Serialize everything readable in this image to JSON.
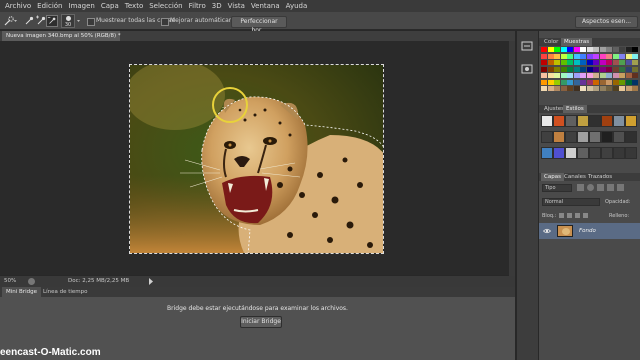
{
  "menu": [
    "Archivo",
    "Edición",
    "Imagen",
    "Capa",
    "Texto",
    "Selección",
    "Filtro",
    "3D",
    "Vista",
    "Ventana",
    "Ayuda"
  ],
  "options": {
    "brush_size": "30",
    "sample_all_layers": "Muestrear todas las capas",
    "auto_enhance": "Mejorar automáticamente",
    "refine_edge": "Perfeccionar bor...",
    "workspace": "Aspectos esen..."
  },
  "document": {
    "tab_title": "Nueva imagen 340.bmp al 50% (RGB/8) *"
  },
  "status": {
    "zoom": "50%",
    "doc_info": "Doc: 2,25 MB/2,25 MB"
  },
  "bottom_panel": {
    "tabs": [
      "Mini Bridge",
      "Línea de tiempo"
    ],
    "message": "Bridge debe estar ejecutándose para examinar los archivos.",
    "button": "Iniciar Bridge"
  },
  "color_panel": {
    "tabs": [
      "Color",
      "Muestras"
    ],
    "active": "Muestras"
  },
  "styles_panel": {
    "tabs": [
      "Ajustes",
      "Estilos"
    ],
    "active": "Estilos"
  },
  "layers_panel": {
    "tabs": [
      "Capas",
      "Canales",
      "Trazados"
    ],
    "filter_kind": "Tipo",
    "blend_mode": "Normal",
    "opacity_label": "Opacidad:",
    "lock_label": "Bloq.:",
    "fill_label": "Relleno:",
    "layer_name": "Fondo"
  },
  "watermark": "eencast-O-Matic.com",
  "colors": {
    "accent": "#3b6ea8",
    "selection_circle": "#e8d23a"
  },
  "swatches": [
    [
      "#ff0000",
      "#ffff00",
      "#00ff00",
      "#00ffff",
      "#0000ff",
      "#ff00ff",
      "#ffffff",
      "#e0e0e0",
      "#c0c0c0",
      "#a0a0a0",
      "#808080",
      "#606060",
      "#404040",
      "#202020",
      "#000000"
    ],
    [
      "#ff4040",
      "#ff8040",
      "#ffc040",
      "#c0ff40",
      "#40ff80",
      "#40c0ff",
      "#4080ff",
      "#8040ff",
      "#c040ff",
      "#ff40c0",
      "#f08080",
      "#80f080",
      "#8080f0",
      "#f0f080",
      "#80f0f0"
    ],
    [
      "#c00000",
      "#c06000",
      "#c0c000",
      "#60c000",
      "#00c060",
      "#00c0c0",
      "#0060c0",
      "#0000c0",
      "#6000c0",
      "#c000c0",
      "#c00060",
      "#a05050",
      "#50a050",
      "#5050a0",
      "#a0a050"
    ],
    [
      "#800000",
      "#804000",
      "#808000",
      "#408000",
      "#008040",
      "#008080",
      "#004080",
      "#000080",
      "#400080",
      "#800080",
      "#800040",
      "#704030",
      "#307040",
      "#304070",
      "#707030"
    ],
    [
      "#f8c0a0",
      "#f8e0a0",
      "#e0f8a0",
      "#a0f8c0",
      "#a0e0f8",
      "#a0a0f8",
      "#e0a0f8",
      "#f8a0e0",
      "#d0b090",
      "#b0d090",
      "#90b0d0",
      "#d090b0",
      "#c8a060",
      "#a06040",
      "#603020"
    ],
    [
      "#ff9900",
      "#ffcc00",
      "#99cc00",
      "#339966",
      "#3399cc",
      "#336699",
      "#663399",
      "#993366",
      "#cc6600",
      "#996633",
      "#cc9966",
      "#996600",
      "#669900",
      "#006633",
      "#003366"
    ],
    [
      "#f0d8b0",
      "#d8b088",
      "#b08860",
      "#886040",
      "#604020",
      "#403020",
      "#f0e0c0",
      "#d0c0a0",
      "#b0a080",
      "#908060",
      "#706040",
      "#504020",
      "#e8c898",
      "#c8a070",
      "#a07848"
    ]
  ],
  "styles": [
    [
      "#e8e8e8",
      "#d05020",
      "#606060",
      "#c0a040",
      "#303030",
      "#a04010",
      "#8090a0",
      "#d0a030"
    ],
    [
      "#404040",
      "#c08040",
      "#404040",
      "#a0a0a0",
      "#707070",
      "#202020",
      "#505050",
      "#303030"
    ],
    [
      "#4080c0",
      "#5050d0",
      "#d0d0d0",
      "#606060",
      "#404040",
      "#404040",
      "#383838",
      "#383838"
    ]
  ]
}
